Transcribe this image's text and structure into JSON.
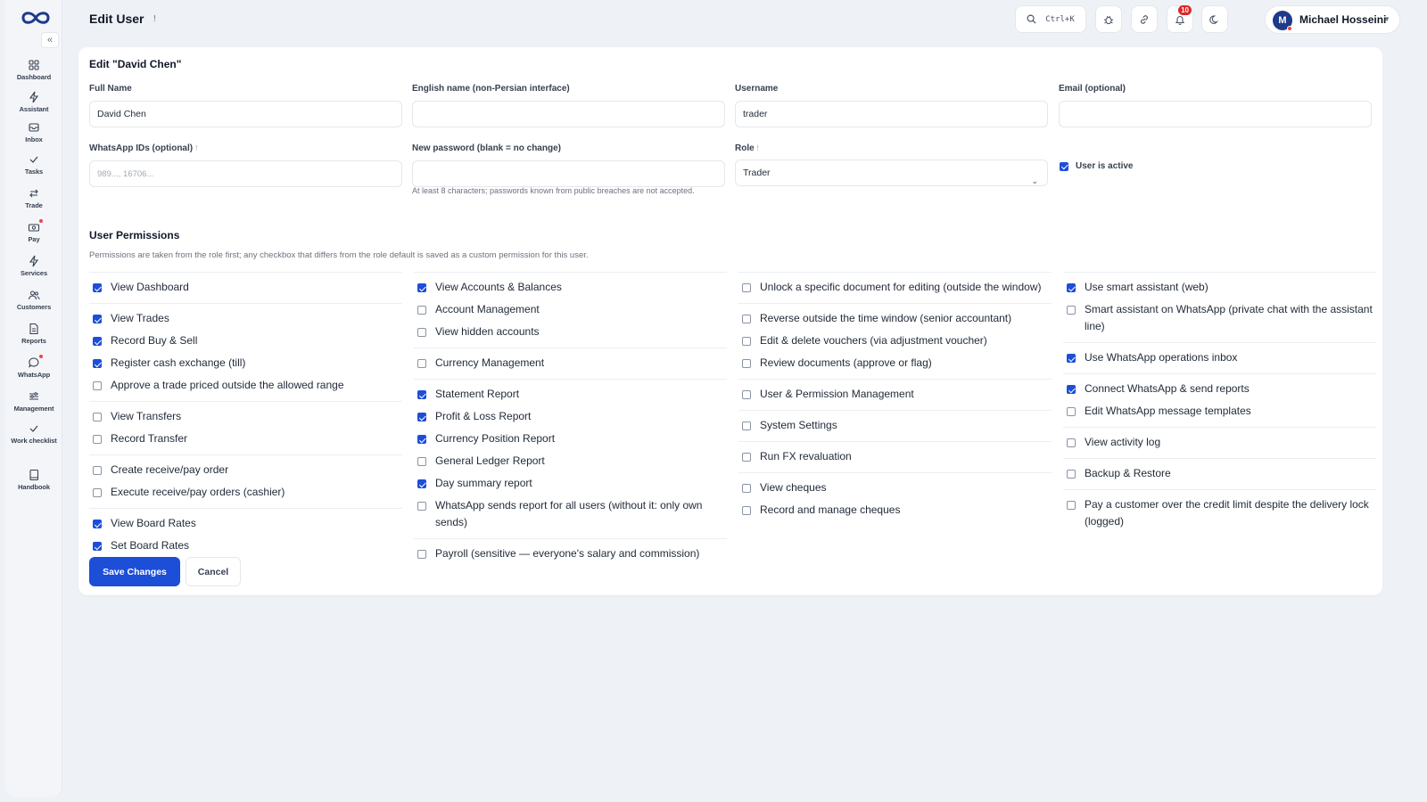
{
  "header": {
    "title": "Edit User",
    "title_info": "!",
    "search_shortcut": "Ctrl+K",
    "notification_count": "10",
    "user_initial": "M",
    "user_name": "Michael Hosseini"
  },
  "sidebar": {
    "collapse": "«",
    "items": [
      {
        "label": "Dashboard",
        "icon": "grid-icon"
      },
      {
        "label": "Assistant",
        "icon": "bolt-icon"
      },
      {
        "label": "Inbox",
        "icon": "inbox-icon"
      },
      {
        "label": "Tasks",
        "icon": "check-icon"
      },
      {
        "label": "Trade",
        "icon": "swap-icon"
      },
      {
        "label": "Pay",
        "icon": "cash-icon"
      },
      {
        "label": "Services",
        "icon": "bolt-icon"
      },
      {
        "label": "Customers",
        "icon": "users-icon"
      },
      {
        "label": "Reports",
        "icon": "file-icon"
      },
      {
        "label": "WhatsApp",
        "icon": "chat-icon"
      },
      {
        "label": "Management",
        "icon": "sliders-icon"
      },
      {
        "label": "Work checklist",
        "icon": "check-icon"
      },
      {
        "label": "Handbook",
        "icon": "book-icon"
      }
    ]
  },
  "form": {
    "title": "Edit \"David Chen\"",
    "full_name_label": "Full Name",
    "full_name_value": "David Chen",
    "english_name_label": "English name (non-Persian interface)",
    "english_name_value": "",
    "username_label": "Username",
    "username_value": "trader",
    "email_label": "Email (optional)",
    "email_value": "",
    "whatsapp_label": "WhatsApp IDs (optional)",
    "whatsapp_placeholder": "989..., 16706...",
    "password_label": "New password (blank = no change)",
    "password_hint": "At least 8 characters; passwords known from public breaches are not accepted.",
    "role_label": "Role",
    "role_value": "Trader",
    "active_label": "User is active",
    "info_mark": "!"
  },
  "permissions": {
    "title": "User Permissions",
    "description": "Permissions are taken from the role first; any checkbox that differs from the role default is saved as a custom permission for this user.",
    "columns": [
      [
        [
          {
            "label": "View Dashboard",
            "checked": true
          }
        ],
        [
          {
            "label": "View Trades",
            "checked": true
          },
          {
            "label": "Record Buy & Sell",
            "checked": true
          },
          {
            "label": "Register cash exchange (till)",
            "checked": true
          },
          {
            "label": "Approve a trade priced outside the allowed range",
            "checked": false
          }
        ],
        [
          {
            "label": "View Transfers",
            "checked": false
          },
          {
            "label": "Record Transfer",
            "checked": false
          }
        ],
        [
          {
            "label": "Create receive/pay order",
            "checked": false
          },
          {
            "label": "Execute receive/pay orders (cashier)",
            "checked": false
          }
        ],
        [
          {
            "label": "View Board Rates",
            "checked": true
          },
          {
            "label": "Set Board Rates",
            "checked": true
          }
        ]
      ],
      [
        [
          {
            "label": "View Accounts & Balances",
            "checked": true
          },
          {
            "label": "Account Management",
            "checked": false
          },
          {
            "label": "View hidden accounts",
            "checked": false
          }
        ],
        [
          {
            "label": "Currency Management",
            "checked": false
          }
        ],
        [
          {
            "label": "Statement Report",
            "checked": true
          },
          {
            "label": "Profit & Loss Report",
            "checked": true
          },
          {
            "label": "Currency Position Report",
            "checked": true
          },
          {
            "label": "General Ledger Report",
            "checked": false
          },
          {
            "label": "Day summary report",
            "checked": true
          },
          {
            "label": "WhatsApp sends report for all users (without it: only own sends)",
            "checked": false
          }
        ],
        [
          {
            "label": "Payroll (sensitive — everyone's salary and commission)",
            "checked": false
          }
        ]
      ],
      [
        [
          {
            "label": "Unlock a specific document for editing (outside the window)",
            "checked": false
          }
        ],
        [
          {
            "label": "Reverse outside the time window (senior accountant)",
            "checked": false
          },
          {
            "label": "Edit & delete vouchers (via adjustment voucher)",
            "checked": false
          },
          {
            "label": "Review documents (approve or flag)",
            "checked": false
          }
        ],
        [
          {
            "label": "User & Permission Management",
            "checked": false
          }
        ],
        [
          {
            "label": "System Settings",
            "checked": false
          }
        ],
        [
          {
            "label": "Run FX revaluation",
            "checked": false
          }
        ],
        [
          {
            "label": "View cheques",
            "checked": false
          },
          {
            "label": "Record and manage cheques",
            "checked": false
          }
        ]
      ],
      [
        [
          {
            "label": "Use smart assistant (web)",
            "checked": true
          },
          {
            "label": "Smart assistant on WhatsApp (private chat with the assistant line)",
            "checked": false
          }
        ],
        [
          {
            "label": "Use WhatsApp operations inbox",
            "checked": true
          }
        ],
        [
          {
            "label": "Connect WhatsApp & send reports",
            "checked": true
          },
          {
            "label": "Edit WhatsApp message templates",
            "checked": false
          }
        ],
        [
          {
            "label": "View activity log",
            "checked": false
          }
        ],
        [
          {
            "label": "Backup & Restore",
            "checked": false
          }
        ],
        [
          {
            "label": "Pay a customer over the credit limit despite the delivery lock (logged)",
            "checked": false
          }
        ]
      ]
    ]
  },
  "actions": {
    "save": "Save Changes",
    "cancel": "Cancel"
  },
  "colors": {
    "accent": "#1d4ed8",
    "notification": "#dc2626",
    "avatar": "#1e3a8a"
  }
}
